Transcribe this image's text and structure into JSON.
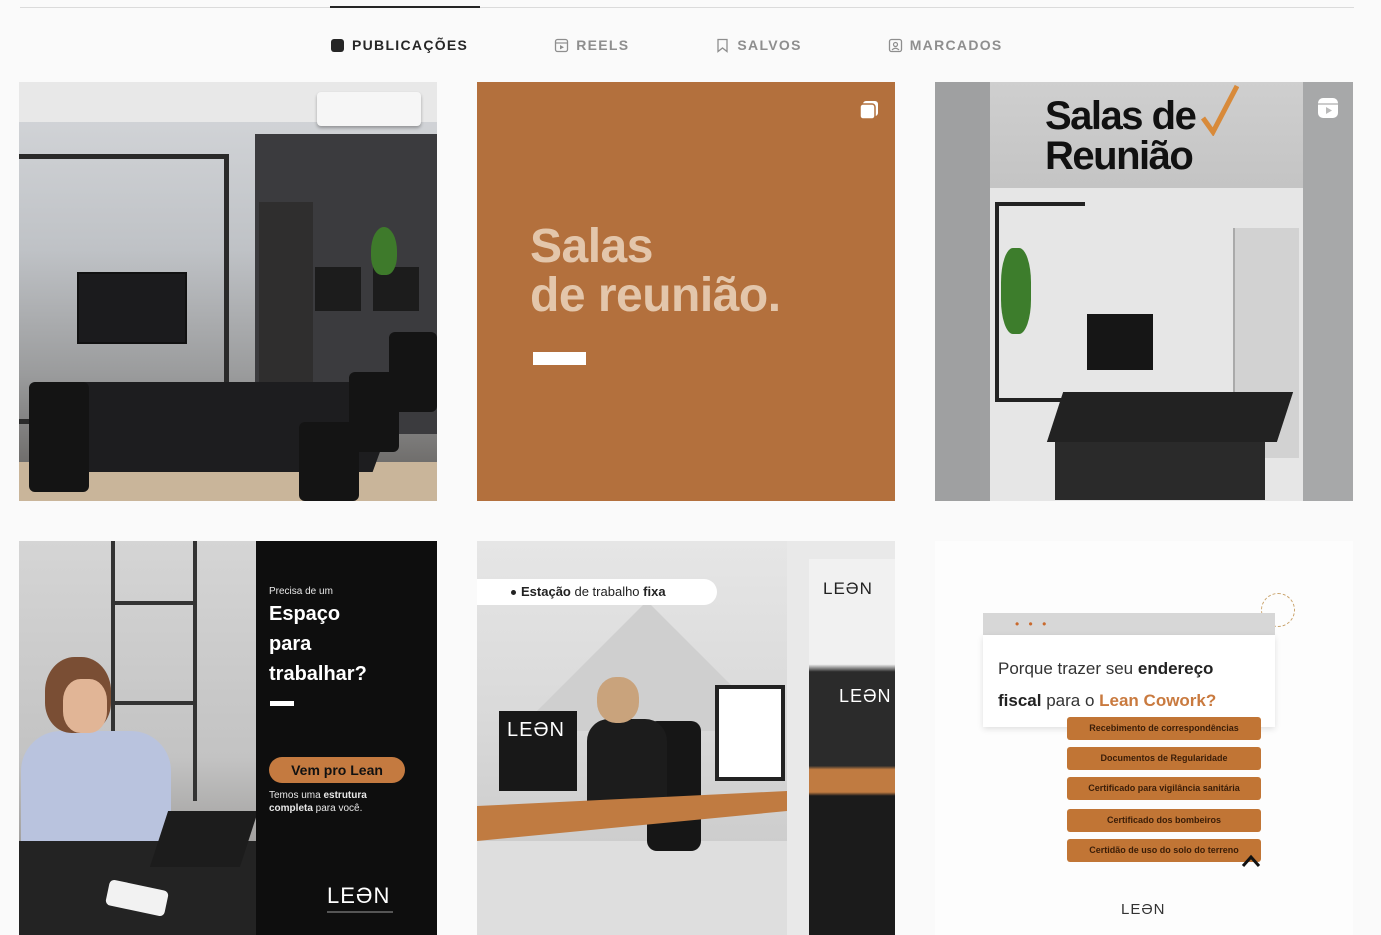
{
  "tabs": [
    {
      "label": "PUBLICAÇÕES",
      "icon": "grid-icon",
      "active": true
    },
    {
      "label": "REELS",
      "icon": "reels-icon",
      "active": false
    },
    {
      "label": "SALVOS",
      "icon": "bookmark-icon",
      "active": false
    },
    {
      "label": "MARCADOS",
      "icon": "tagged-icon",
      "active": false
    }
  ],
  "posts": {
    "post2": {
      "headline_line1": "Salas",
      "headline_line2": "de reunião."
    },
    "post3": {
      "title_line1": "Salas de",
      "title_line2": "Reunião"
    },
    "post4": {
      "small": "Precisa de um",
      "big_line1": "Espaço",
      "big_line2": "para",
      "big_line3": "trabalhar?",
      "cta": "Vem pro Lean",
      "tag_plain1": "Temos uma ",
      "tag_bold1": "estrutura",
      "tag_bold2": "completa",
      "tag_plain2": " para você.",
      "logo": "LEƏN"
    },
    "post5": {
      "label_bold1": "Estação",
      "label_plain": " de trabalho ",
      "label_bold2": "fixa",
      "monitor_logo": "LEƏN",
      "side_logo": "LEƏN",
      "side_logo2": "LEƏN"
    },
    "post6": {
      "dots": "• • •",
      "q_plain1": "Porque trazer seu ",
      "q_bold1": "endereço",
      "q_bold2": "fiscal",
      "q_plain2": " para o ",
      "q_accent": "Lean Cowork?",
      "items": [
        "Recebimento de correspondências",
        "Documentos de Regularidade",
        "Certificado para vigilância sanitária",
        "Certificado dos bombeiros",
        "Certidão de uso do solo do terreno"
      ],
      "logo": "LEƏN"
    }
  },
  "colors": {
    "brand_brown": "#b3703d",
    "accent_orange": "#c17535",
    "tab_active": "#262626",
    "tab_inactive": "#8e8e8e"
  }
}
